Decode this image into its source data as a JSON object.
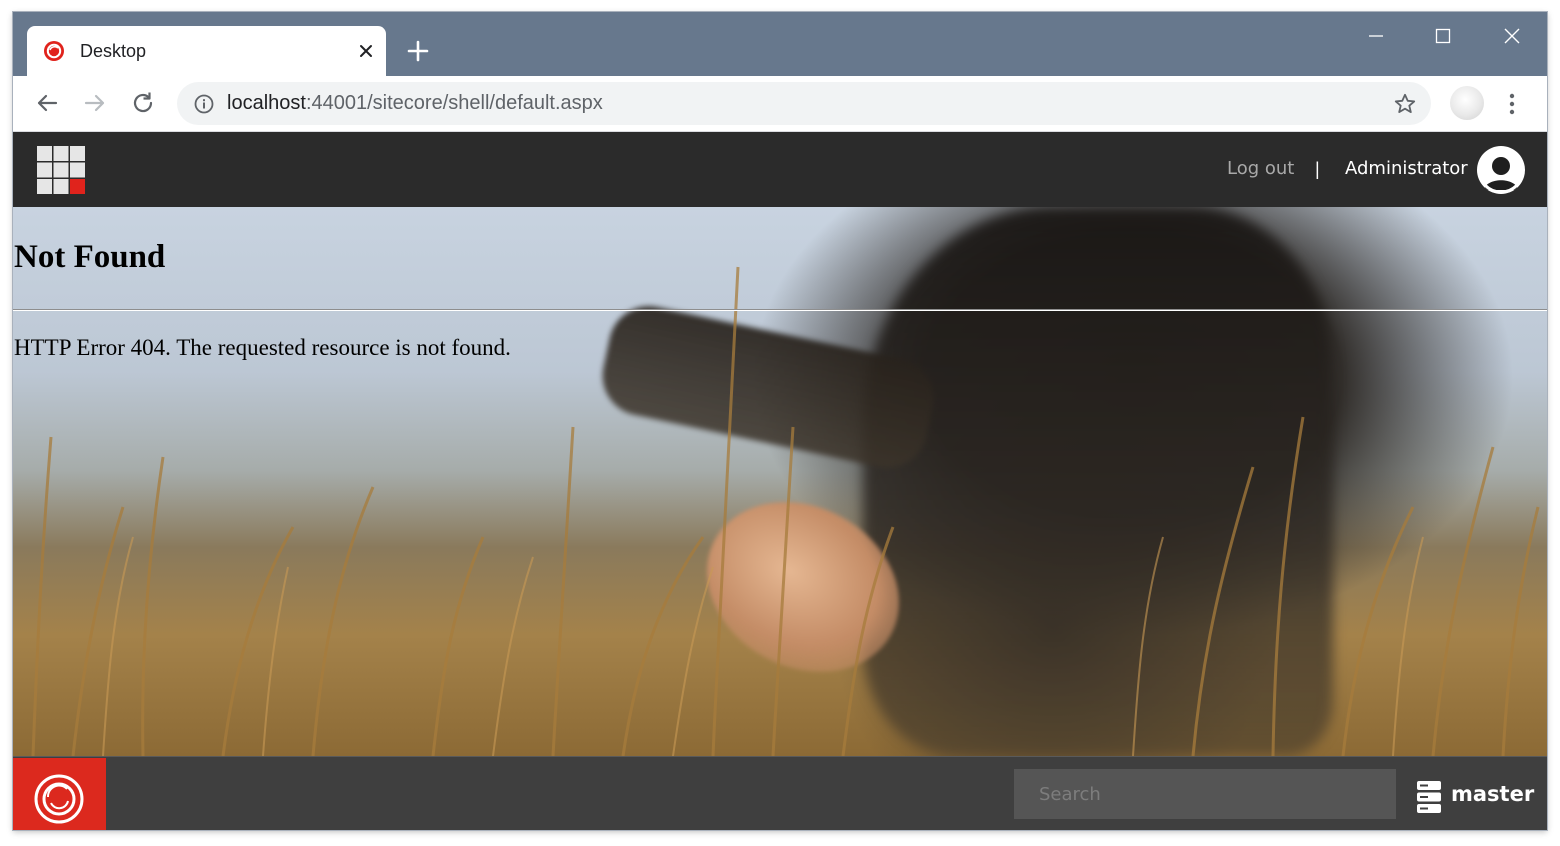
{
  "browser": {
    "tab": {
      "title": "Desktop",
      "favicon": "sitecore-icon"
    },
    "address": {
      "host": "localhost",
      "rest": ":44001/sitecore/shell/default.aspx"
    },
    "controls": [
      "back-icon",
      "forward-icon",
      "reload-icon",
      "info-icon",
      "star-icon",
      "kebab-menu-icon"
    ]
  },
  "header": {
    "logout_label": "Log out",
    "separator": "|",
    "username": "Administrator"
  },
  "page": {
    "title": "Not Found",
    "message": "HTTP Error 404. The requested resource is not found."
  },
  "taskbar": {
    "search_placeholder": "Search",
    "database": "master"
  },
  "colors": {
    "tabstrip": "#67788d",
    "header_bg": "#2b2b2b",
    "taskbar_bg": "#3f3f3f",
    "start_red": "#dc291e",
    "launchpad_red": "#e0231c"
  }
}
